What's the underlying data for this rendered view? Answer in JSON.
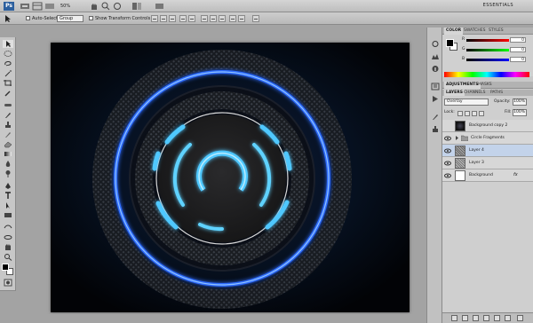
{
  "app": {
    "logo": "Ps",
    "zoom": "50%",
    "workspace": "ESSENTIALS"
  },
  "options": {
    "auto_select_label": "Auto-Select:",
    "auto_select_value": "Group",
    "show_transform_label": "Show Transform Controls"
  },
  "color_panel": {
    "tabs": [
      "COLOR",
      "SWATCHES",
      "STYLES"
    ],
    "channels": [
      {
        "label": "R",
        "value": "0",
        "color": "#e03030"
      },
      {
        "label": "G",
        "value": "0",
        "color": "#30b030"
      },
      {
        "label": "B",
        "value": "0",
        "color": "#3050e0"
      }
    ]
  },
  "adjustments_panel": {
    "tabs": [
      "ADJUSTMENTS",
      "MASKS"
    ]
  },
  "layers_panel": {
    "tabs": [
      "LAYERS",
      "CHANNELS",
      "PATHS"
    ],
    "blend_mode": "Overlay",
    "opacity_label": "Opacity:",
    "opacity": "100%",
    "lock_label": "Lock:",
    "fill_label": "Fill:",
    "fill": "100%",
    "layers": [
      {
        "name": "Background copy 2",
        "selected": false
      },
      {
        "name": "Circle Fragments",
        "selected": false,
        "group": true
      },
      {
        "name": "Layer 4",
        "selected": true
      },
      {
        "name": "Layer 3",
        "selected": false
      },
      {
        "name": "Background",
        "selected": false
      }
    ],
    "fx_label": "fx"
  },
  "colors": {
    "glow": "#4fc8ff",
    "ring_blue": "#2f6cff",
    "canvas_bg": "#04060b"
  }
}
